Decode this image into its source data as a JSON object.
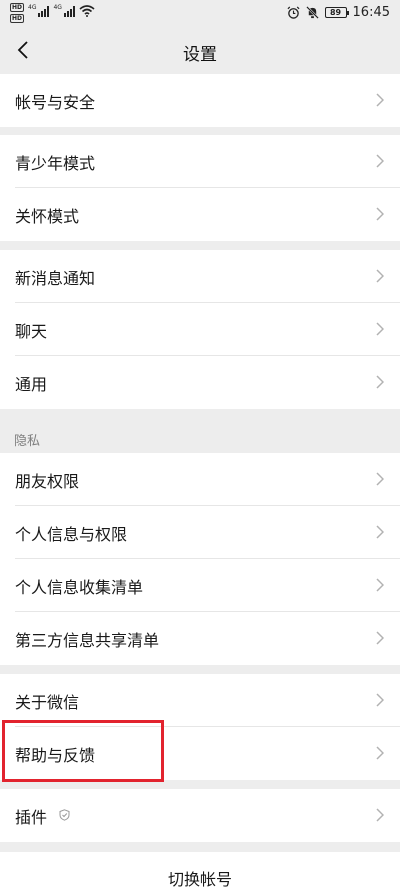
{
  "status_bar": {
    "hd1": "HD",
    "hd2": "HD",
    "sig1_label": "4G",
    "sig2_label": "4G",
    "battery": "89",
    "time": "16:45",
    "icons": [
      "alarm-icon",
      "mute-bell-icon",
      "wifi-icon"
    ]
  },
  "navbar": {
    "title": "设置",
    "back_icon": "chevron-left-icon"
  },
  "groups": {
    "account": {
      "items": [
        {
          "label": "帐号与安全"
        }
      ]
    },
    "modes": {
      "items": [
        {
          "label": "青少年模式"
        },
        {
          "label": "关怀模式"
        }
      ]
    },
    "general": {
      "items": [
        {
          "label": "新消息通知"
        },
        {
          "label": "聊天"
        },
        {
          "label": "通用"
        }
      ]
    },
    "privacy": {
      "header": "隐私",
      "items": [
        {
          "label": "朋友权限"
        },
        {
          "label": "个人信息与权限"
        },
        {
          "label": "个人信息收集清单"
        },
        {
          "label": "第三方信息共享清单"
        }
      ]
    },
    "about": {
      "items": [
        {
          "label": "关于微信"
        },
        {
          "label": "帮助与反馈"
        }
      ]
    },
    "plugins": {
      "items": [
        {
          "label": "插件",
          "icon": "shield-icon"
        }
      ]
    }
  },
  "switch_account": {
    "label": "切换帐号"
  },
  "colors": {
    "highlight": "#e2232e",
    "background": "#ededed"
  }
}
